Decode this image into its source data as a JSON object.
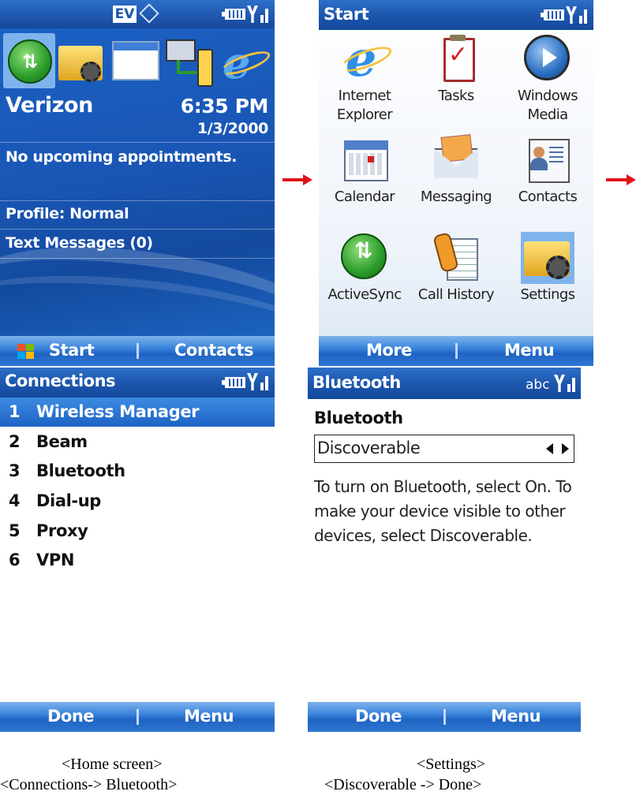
{
  "home": {
    "status_label": "EV",
    "carrier": "Verizon",
    "time": "6:35 PM",
    "date": "1/3/2000",
    "appointments": "No upcoming appointments.",
    "profile": "Profile: Normal",
    "messages": "Text Messages (0)",
    "soft_left": "Start",
    "soft_right": "Contacts"
  },
  "start_menu": {
    "title": "Start",
    "items": [
      {
        "line1": "Internet",
        "line2": "Explorer",
        "icon": "internet-explorer-icon"
      },
      {
        "line1": "Tasks",
        "line2": "",
        "icon": "tasks-icon"
      },
      {
        "line1": "Windows",
        "line2": "Media",
        "icon": "windows-media-icon"
      },
      {
        "line1": "Calendar",
        "line2": "",
        "icon": "calendar-icon"
      },
      {
        "line1": "Messaging",
        "line2": "",
        "icon": "messaging-icon"
      },
      {
        "line1": "Contacts",
        "line2": "",
        "icon": "contacts-icon"
      },
      {
        "line1": "ActiveSync",
        "line2": "",
        "icon": "activesync-icon"
      },
      {
        "line1": "Call History",
        "line2": "",
        "icon": "call-history-icon"
      },
      {
        "line1": "Settings",
        "line2": "",
        "icon": "settings-icon"
      }
    ],
    "soft_left": "More",
    "soft_right": "Menu"
  },
  "connections": {
    "title": "Connections",
    "items": [
      {
        "num": "1",
        "label": "Wireless Manager"
      },
      {
        "num": "2",
        "label": "Beam"
      },
      {
        "num": "3",
        "label": "Bluetooth"
      },
      {
        "num": "4",
        "label": "Dial-up"
      },
      {
        "num": "5",
        "label": "Proxy"
      },
      {
        "num": "6",
        "label": "VPN"
      }
    ],
    "soft_left": "Done",
    "soft_right": "Menu"
  },
  "bluetooth": {
    "title": "Bluetooth",
    "input_mode": "abc",
    "heading": "Bluetooth",
    "selected_value": "Discoverable",
    "help_line1": "To turn on Bluetooth, select On. To",
    "help_line2": "make your device visible to other",
    "help_line3": "devices, select Discoverable.",
    "soft_left": "Done",
    "soft_right": "Menu"
  },
  "captions": {
    "home": "<Home screen>",
    "settings": "<Settings>",
    "connections": "<Connections-> Bluetooth>",
    "discoverable": "<Discoverable -> Done>"
  },
  "colors": {
    "titlebar": "#1c55ab",
    "selection": "#2d74d3",
    "arrow": "#e0121b"
  }
}
